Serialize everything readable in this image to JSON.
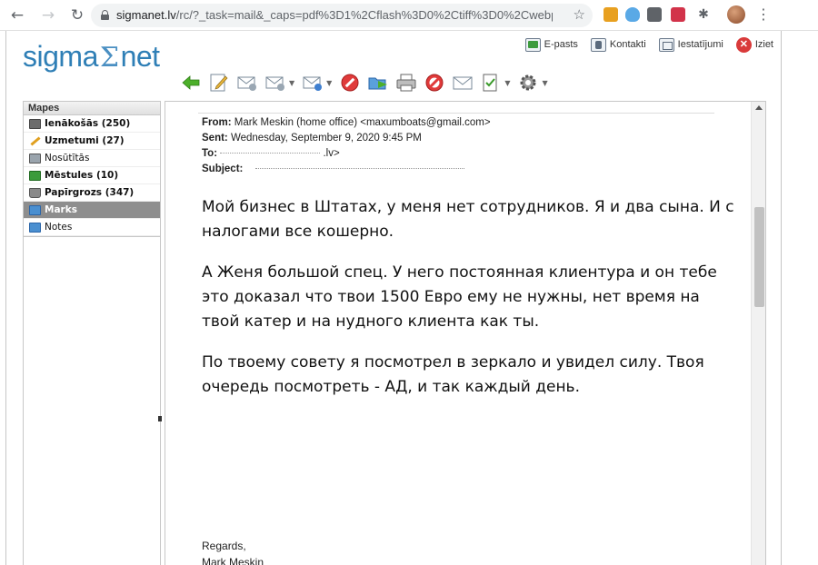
{
  "browser": {
    "url_host": "sigmanet.lv",
    "url_path": "/rc/?_task=mail&_caps=pdf%3D1%2Cflash%3D0%2Ctiff%3D0%2Cwebp..."
  },
  "app": {
    "logo_left": "sigma",
    "logo_symbol": "Σ",
    "logo_right": "net",
    "brand_color": "#2f7fb6"
  },
  "toplinks": [
    {
      "label": "E-pasts",
      "icon": "mail-icon"
    },
    {
      "label": "Kontakti",
      "icon": "contacts-icon"
    },
    {
      "label": "Iestatījumi",
      "icon": "settings-icon"
    },
    {
      "label": "Iziet",
      "icon": "logout-icon"
    }
  ],
  "folders": {
    "header": "Mapes",
    "items": [
      {
        "label": "Ienākošās (250)",
        "icon": "inbox-icon"
      },
      {
        "label": "Uzmetumi (27)",
        "icon": "drafts-icon"
      },
      {
        "label": "Nosūtītās",
        "icon": "sent-icon"
      },
      {
        "label": "Mēstules (10)",
        "icon": "junk-icon"
      },
      {
        "label": "Papīrgrozs (347)",
        "icon": "trash-icon"
      },
      {
        "label": "Marks",
        "icon": "folder-icon"
      },
      {
        "label": "Notes",
        "icon": "folder-icon"
      }
    ]
  },
  "message": {
    "from_label": "From:",
    "from_value": "Mark Meskin (home office) <maxumboats@gmail.com>",
    "sent_label": "Sent:",
    "sent_value": "Wednesday, September 9, 2020 9:45 PM",
    "to_label": "To:",
    "to_value": ".lv>",
    "subject_label": "Subject:",
    "body": [
      "Мой бизнес в Штатах, у меня нет сотрудников. Я и два сына. И с налогами все кошерно.",
      "А Женя большой спец. У него постоянная клиентура и он тебе это доказал что твои 1500 Евро ему не нужны, нет время на твой катер и на нудного клиента как ты.",
      "По твоему совету я посмотрел в зеркало и увидел силу. Твоя очередь посмотреть - АД, и так каждый день."
    ],
    "signature_1": "Regards,",
    "signature_2": "Mark Meskin"
  }
}
